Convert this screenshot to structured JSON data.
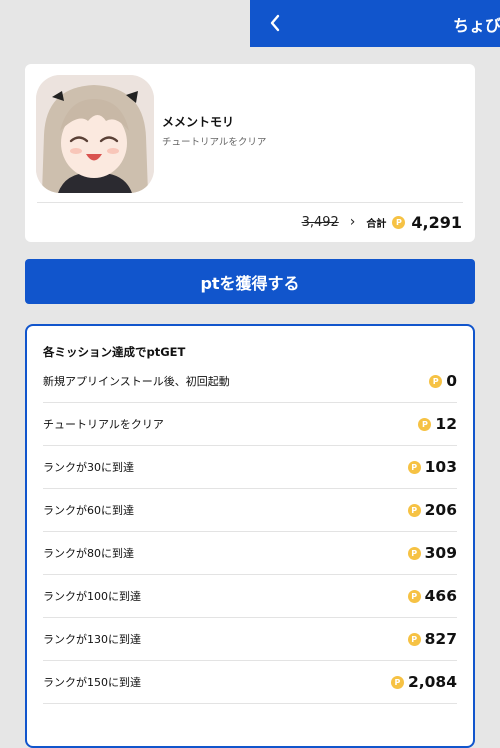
{
  "header": {
    "title": "ちょび",
    "back_icon": "chevron-left-icon"
  },
  "colors": {
    "brand_blue": "#1155cc",
    "coin_gold": "#f6c244",
    "background": "#e6e6e6"
  },
  "app": {
    "name": "メメントモリ",
    "subtitle": "チュートリアルをクリア",
    "original_pt": "3,492",
    "total_label": "合計",
    "total_pt": "4,291",
    "coin_icon_glyph": "P"
  },
  "get_button": {
    "label": "ptを獲得する"
  },
  "missions": {
    "heading": "各ミッション達成でptGET",
    "items": [
      {
        "label": "新規アプリインストール後、初回起動",
        "pt": "0"
      },
      {
        "label": "チュートリアルをクリア",
        "pt": "12"
      },
      {
        "label": "ランクが30に到達",
        "pt": "103"
      },
      {
        "label": "ランクが60に到達",
        "pt": "206"
      },
      {
        "label": "ランクが80に到達",
        "pt": "309"
      },
      {
        "label": "ランクが100に到達",
        "pt": "466"
      },
      {
        "label": "ランクが130に到達",
        "pt": "827"
      },
      {
        "label": "ランクが150に到達",
        "pt": "2,084"
      }
    ]
  }
}
